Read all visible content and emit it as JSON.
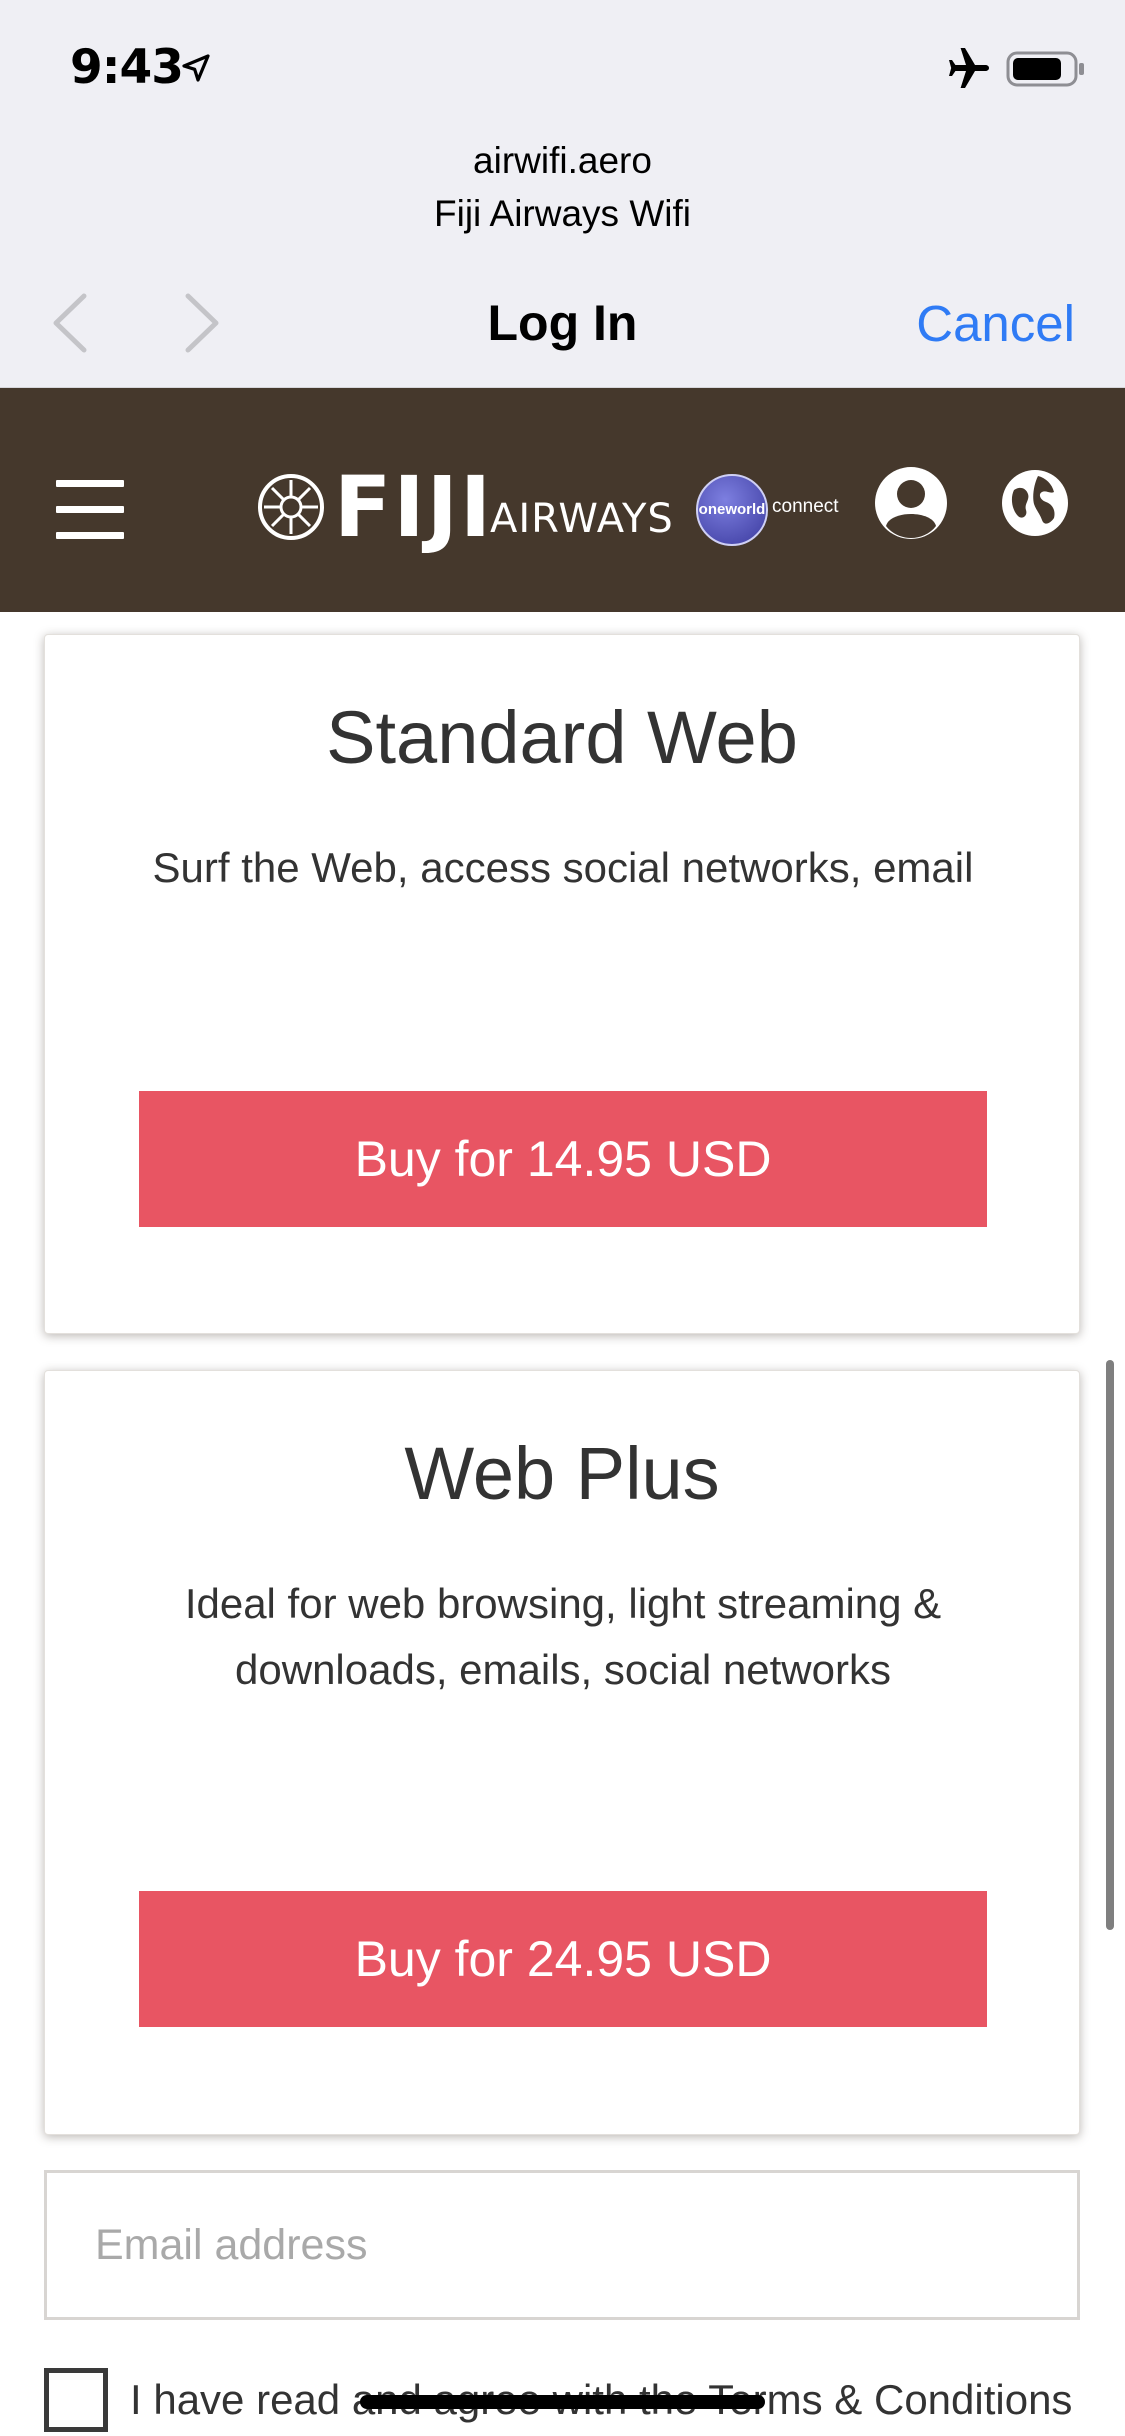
{
  "status_bar": {
    "time": "9:43",
    "icons": [
      "location-arrow-icon",
      "airplane-icon",
      "battery-icon"
    ]
  },
  "browser": {
    "domain": "airwifi.aero",
    "page_title": "Fiji Airways Wifi",
    "nav_title": "Log In",
    "cancel_label": "Cancel",
    "accent_color": "#2f7bf5"
  },
  "site_header": {
    "brand_primary": "FIJI",
    "brand_secondary": "AIRWAYS",
    "partner_badge": "oneworld",
    "partner_suffix": "connect",
    "background_color": "#45382c",
    "icons": [
      "hamburger-menu-icon",
      "user-icon",
      "globe-icon"
    ]
  },
  "plans": [
    {
      "title": "Standard Web",
      "description": "Surf the Web, access social networks, email",
      "button_label": "Buy for 14.95 USD"
    },
    {
      "title": "Web Plus",
      "description": "Ideal for web browsing, light streaming & downloads, emails, social networks",
      "button_label": "Buy for 24.95 USD"
    }
  ],
  "button_color": "#e85563",
  "form": {
    "email_placeholder": "Email address",
    "email_value": "",
    "terms_label": "I have read and agree with the Terms & Conditions",
    "terms_checked": false
  }
}
